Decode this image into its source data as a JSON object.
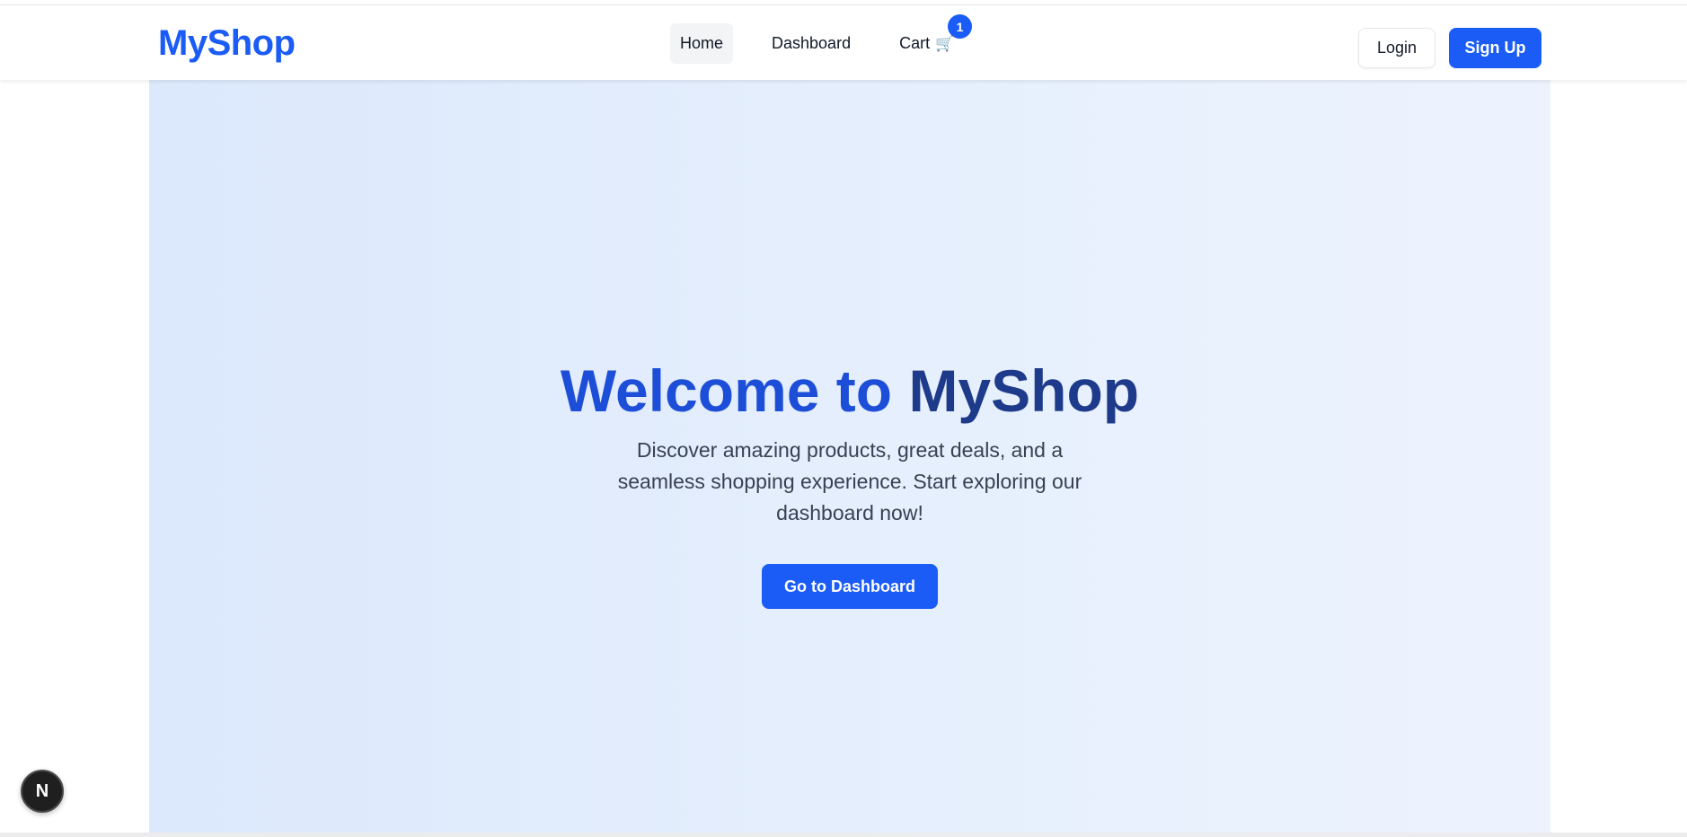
{
  "navbar": {
    "brand": "MyShop",
    "links": [
      {
        "label": "Home",
        "active": true
      },
      {
        "label": "Dashboard",
        "active": false
      },
      {
        "label": "Cart",
        "icon": "🛒",
        "badge": "1"
      }
    ],
    "login_label": "Login",
    "signup_label": "Sign Up"
  },
  "hero": {
    "title_part1": "Welcome to",
    "title_part2": "MyShop",
    "subtitle": "Discover amazing products, great deals, and a seamless shopping experience. Start exploring our dashboard now!",
    "cta_label": "Go to Dashboard"
  },
  "dev_badge": {
    "label": "N",
    "icon": "nextjs-logo-icon"
  },
  "colors": {
    "accent": "#1a5cf5",
    "title_blue": "#1d4ed8",
    "title_navy": "#1e3a8a",
    "hero_bg_start": "#dce8fc",
    "hero_bg_end": "#edf3fe"
  }
}
